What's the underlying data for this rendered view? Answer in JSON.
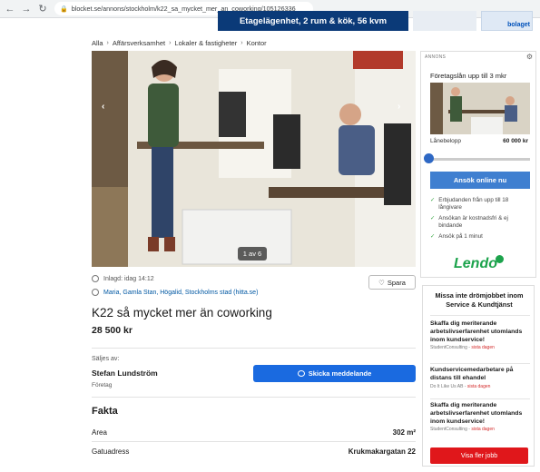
{
  "browser": {
    "url": "blocket.se/annons/stockholm/k22_sa_mycket_mer_an_coworking/105126336"
  },
  "top_ad": {
    "text": "Etagelägenhet, 2 rum & kök, 56 kvm",
    "right_brand": "bolaget"
  },
  "breadcrumb": [
    "Alla",
    "Affärsverksamhet",
    "Lokaler & fastigheter",
    "Kontor"
  ],
  "photo": {
    "counter": "1 av 6"
  },
  "meta": {
    "posted": "Inlagd: idag 14:12",
    "location": "Maria, Gamla Stan, Högalid, Stockholms stad (hitta.se)",
    "save_label": "Spara"
  },
  "listing": {
    "title": "K22 så mycket mer än coworking",
    "price": "28 500 kr"
  },
  "seller": {
    "label": "Säljes av:",
    "name": "Stefan Lundström",
    "type": "Företag",
    "message_button": "Skicka meddelande"
  },
  "fakta": {
    "title": "Fakta",
    "rows": [
      {
        "label": "Area",
        "value": "302 m²"
      },
      {
        "label": "Gatuadress",
        "value": "Krukmakargatan 22"
      }
    ]
  },
  "ad_loan": {
    "annons": "ANNONS",
    "heading": "Företagslån upp till 3 mkr",
    "amount_label": "Lånebelopp",
    "amount_value": "60 000 kr",
    "cta": "Ansök online nu",
    "bullets": [
      "Erbjudanden från upp till 18 långivare",
      "Ansökan är kostnadsfri & ej bindande",
      "Ansök på 1 minut"
    ],
    "brand": "Lendo"
  },
  "ad_jobs": {
    "heading": "Missa inte drömjobbet inom Service & Kundtjänst",
    "jobs": [
      {
        "title": "Skaffa dig meriterande arbetslivserfarenhet utomlands inom kundservice!",
        "company": "StudentConsulting",
        "deadline": "sista dagen"
      },
      {
        "title": "Kundservicemedarbetare på distans till ehandel",
        "company": "Do It Like Us AB",
        "deadline": "sista dagen"
      },
      {
        "title": "Skaffa dig meriterande arbetslivserfarenhet utomlands inom kundservice!",
        "company": "StudentConsulting",
        "deadline": "sista dagen"
      }
    ],
    "more_button": "Visa fler jobb"
  }
}
